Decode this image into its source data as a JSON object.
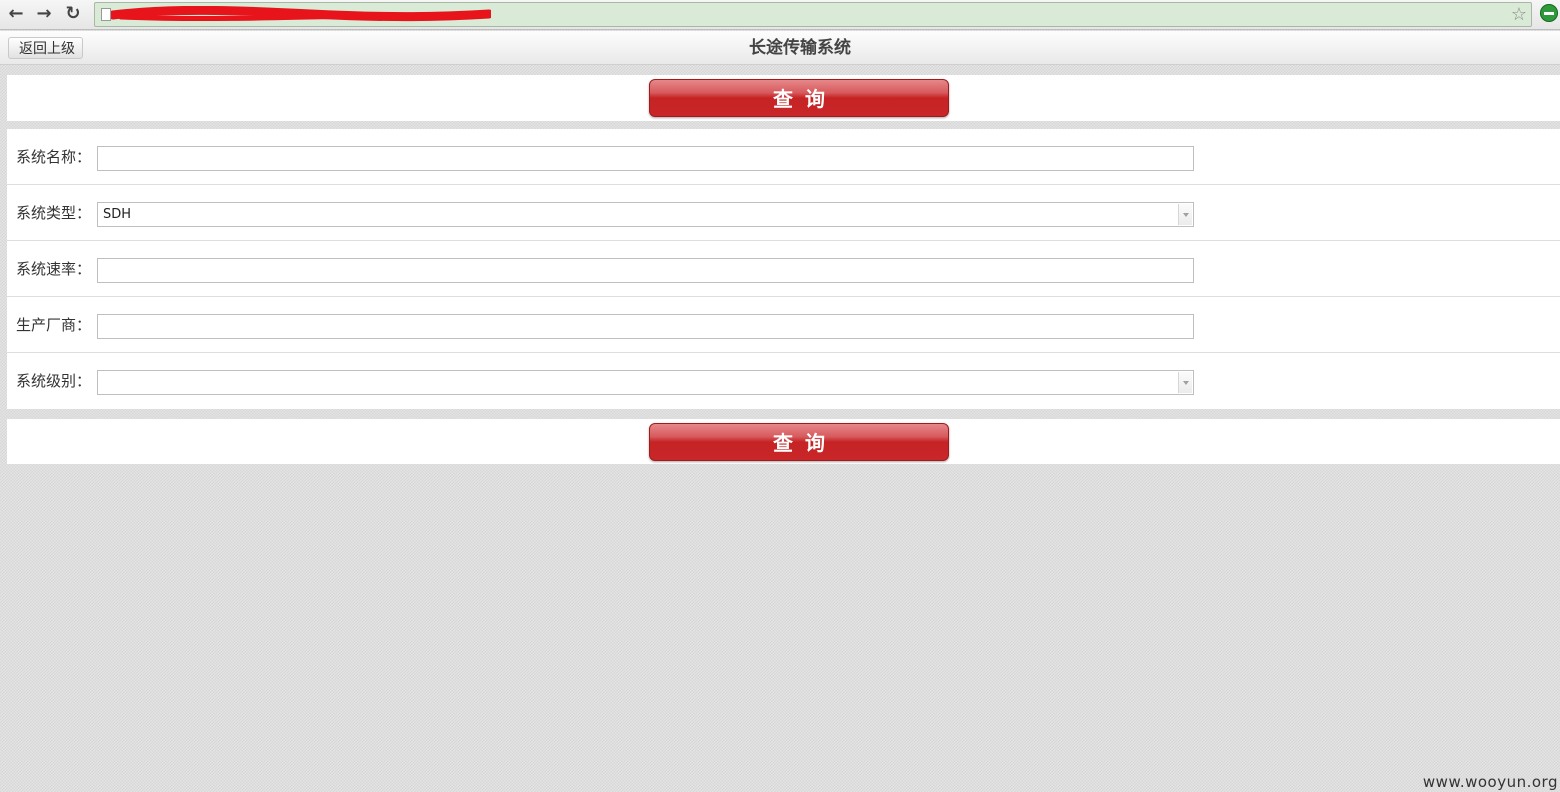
{
  "browser": {
    "url": "",
    "colors": {
      "omnibox_bg": "#d9ebd6",
      "extension_icon": "#2e9a3b"
    },
    "icons": [
      "back-arrow-icon",
      "forward-arrow-icon",
      "reload-icon",
      "page-icon",
      "bookmark-star-icon",
      "extension-icon"
    ]
  },
  "header": {
    "back_label": "返回上级",
    "title": "长途传输系统"
  },
  "actions": {
    "query_label": "查询"
  },
  "form": {
    "fields": [
      {
        "label": "系统名称：",
        "type": "text",
        "value": ""
      },
      {
        "label": "系统类型：",
        "type": "select",
        "value": "SDH"
      },
      {
        "label": "系统速率：",
        "type": "text",
        "value": ""
      },
      {
        "label": "生产厂商：",
        "type": "text",
        "value": ""
      },
      {
        "label": "系统级别：",
        "type": "select",
        "value": ""
      }
    ]
  },
  "colors": {
    "button_red": "#c52324",
    "panel_bg": "#ffffff"
  },
  "watermark": "www.wooyun.org"
}
